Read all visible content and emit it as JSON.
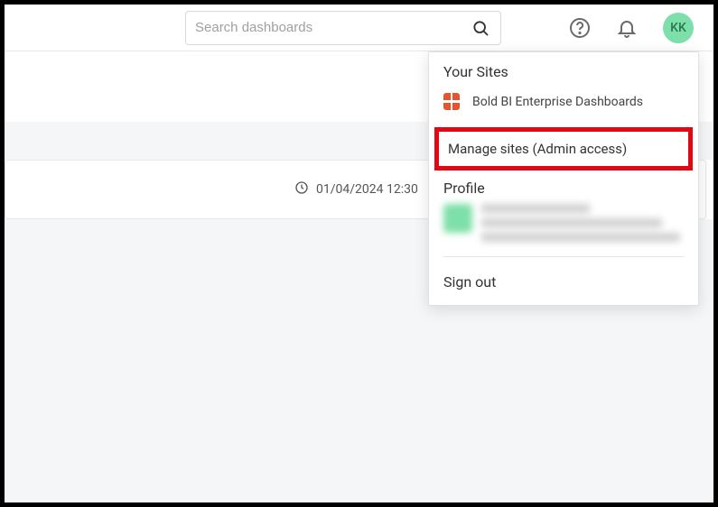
{
  "header": {
    "search_placeholder": "Search dashboards",
    "avatar_initials": "KK"
  },
  "content": {
    "timestamp": "01/04/2024 12:30"
  },
  "dropdown": {
    "sites_title": "Your Sites",
    "sites": [
      {
        "label": "Bold BI Enterprise Dashboards"
      }
    ],
    "manage_label": "Manage sites (Admin access)",
    "profile_title": "Profile",
    "signout_label": "Sign out"
  }
}
